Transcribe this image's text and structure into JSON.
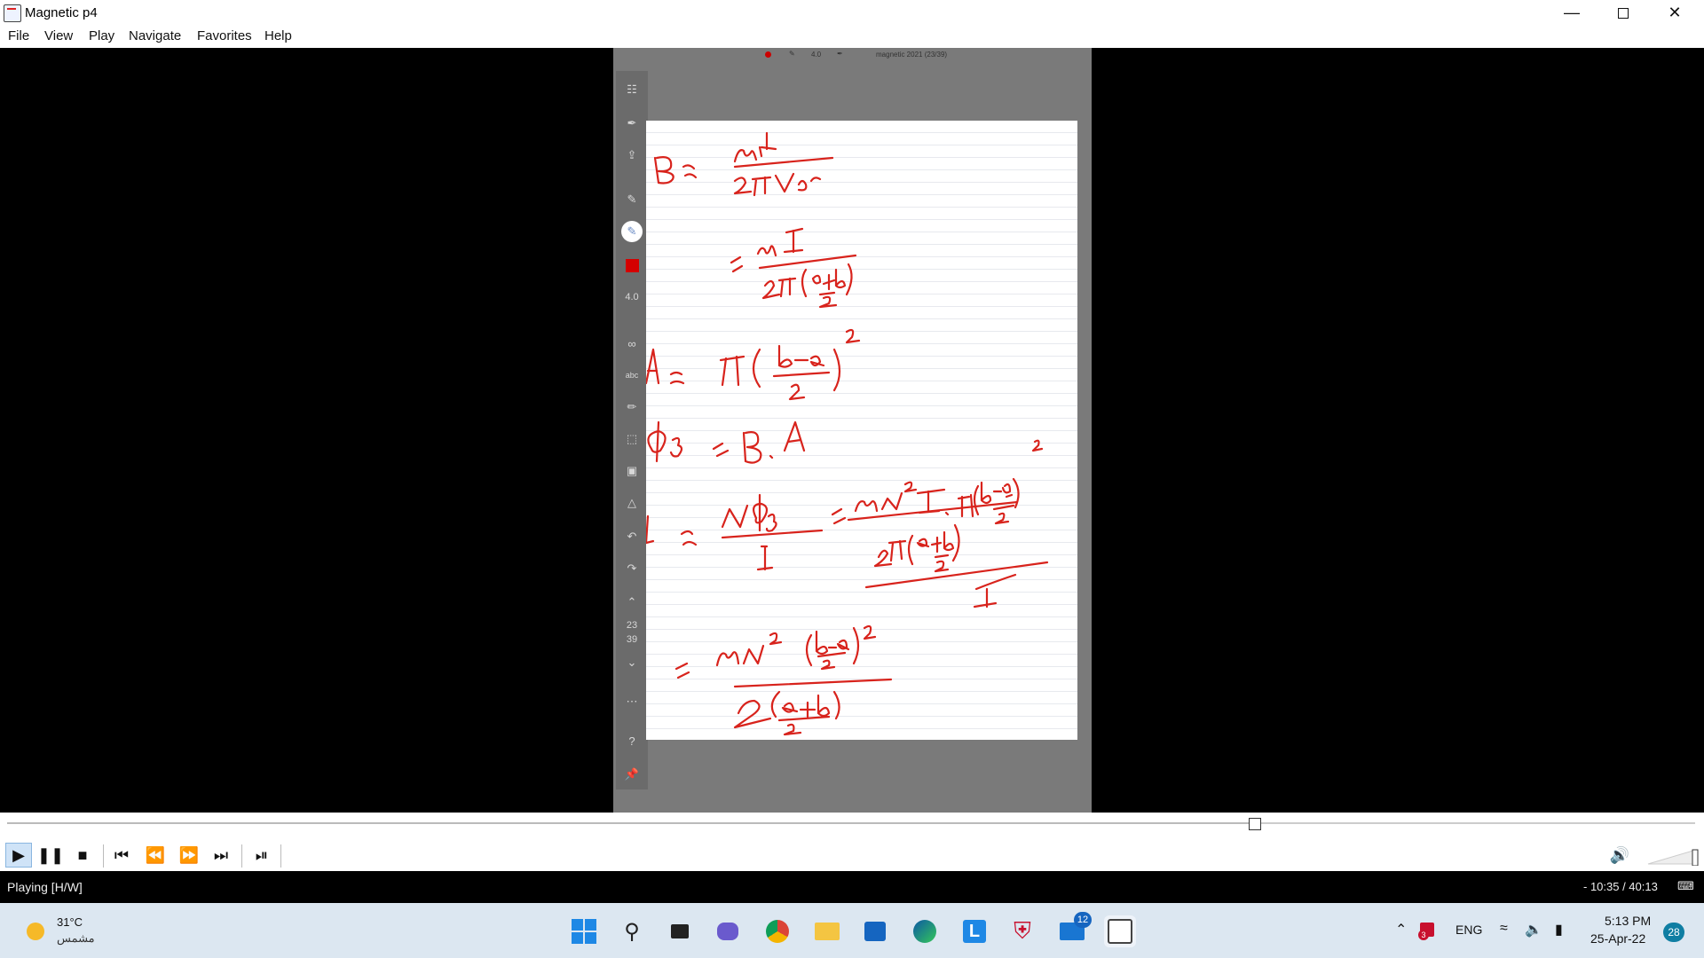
{
  "window": {
    "title": "Magnetic p4",
    "minimize_icon": "minimize-icon",
    "restore_icon": "restore-icon",
    "close_icon": "close-icon"
  },
  "menu": [
    "File",
    "View",
    "Play",
    "Navigate",
    "Favorites",
    "Help"
  ],
  "video": {
    "top_info": {
      "pen_size": "4.0",
      "doc_title": "magnetic 2021 (23/39)"
    },
    "toolbar": {
      "pen_size_label": "4.0",
      "page_current": "23",
      "page_total": "39"
    },
    "handwritten": [
      "B = μI / 2π r_av",
      "= μI / 2π((a+b)/2)",
      "A = π((b-a)/2)^2",
      "Φ_B = B.A",
      "L = NΦ_B / I = μN^2 I π((b-a)/2)^2 / 2π((a+b)/2) I",
      "= μN^2 ((b-a)/2)^2 / 2((a+b)/2)"
    ]
  },
  "playback": {
    "progress": 0.739
  },
  "controls": {
    "play_icon": "play-icon",
    "pause_icon": "pause-icon",
    "stop_icon": "stop-icon",
    "prev_icon": "skip-back-icon",
    "rewind_icon": "rewind-icon",
    "forward_icon": "fast-forward-icon",
    "next_icon": "skip-forward-icon",
    "frame_step_icon": "frame-step-icon",
    "volume_icon": "volume-icon"
  },
  "status": {
    "state": "Playing [H/W]",
    "time": "- 10:35 / 40:13"
  },
  "taskbar": {
    "weather": {
      "temp": "31°C",
      "desc": "مشمس"
    },
    "tray": {
      "lang": "ENG",
      "time": "5:13 PM",
      "date": "25-Apr-22",
      "notif_count": "28",
      "mail_badge": "12",
      "antivirus_badge": "3"
    }
  }
}
